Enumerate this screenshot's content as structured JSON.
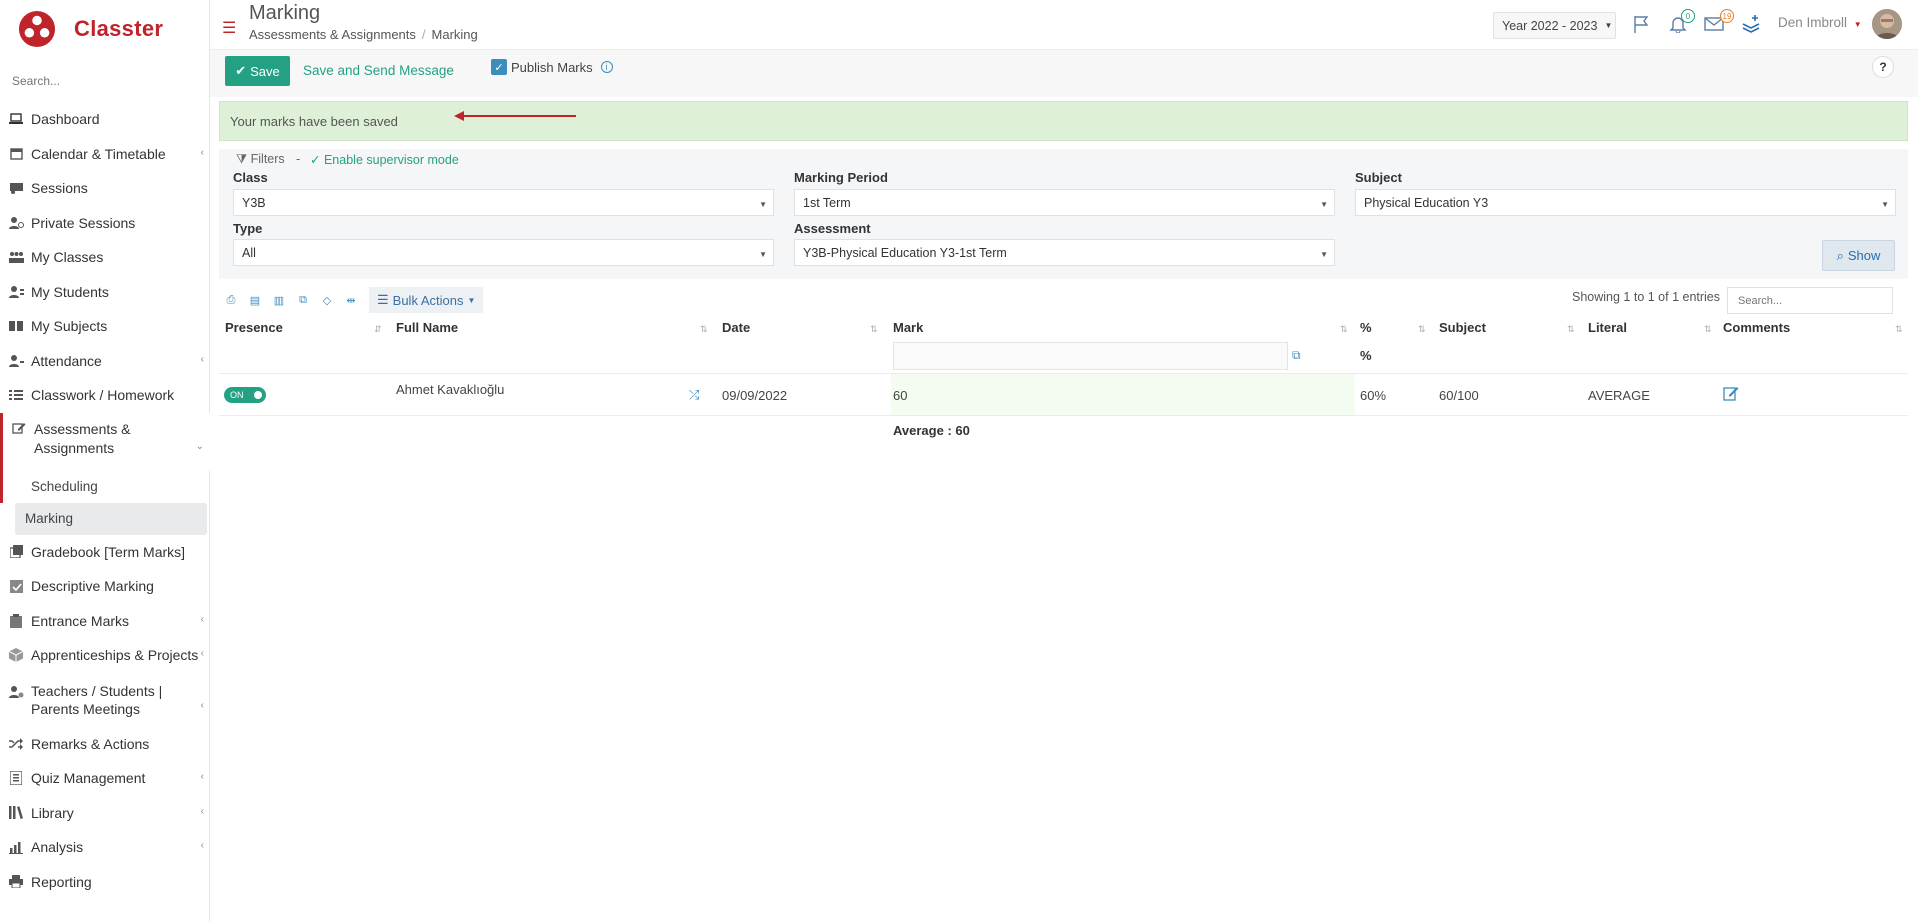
{
  "brand": {
    "name": "Classter",
    "color": "#c0242b"
  },
  "sidebar": {
    "search_placeholder": "Search...",
    "items": [
      {
        "label": "Dashboard",
        "icon": "laptop-icon"
      },
      {
        "label": "Calendar & Timetable",
        "icon": "calendar-icon"
      },
      {
        "label": "Sessions",
        "icon": "sessions-icon"
      },
      {
        "label": "Private Sessions",
        "icon": "private-sessions-icon"
      },
      {
        "label": "My Classes",
        "icon": "classes-icon"
      },
      {
        "label": "My Students",
        "icon": "students-icon"
      },
      {
        "label": "My Subjects",
        "icon": "book-icon"
      },
      {
        "label": "Attendance",
        "icon": "attendance-icon"
      },
      {
        "label": "Classwork / Homework",
        "icon": "list-icon"
      },
      {
        "label": "Assessments & Assignments",
        "icon": "edit-icon"
      },
      {
        "label": "Scheduling"
      },
      {
        "label": "Marking"
      },
      {
        "label": "Gradebook [Term Marks]",
        "icon": "gradebook-icon"
      },
      {
        "label": "Descriptive Marking",
        "icon": "check-square-icon"
      },
      {
        "label": "Entrance Marks",
        "icon": "clipboard-icon"
      },
      {
        "label": "Apprenticeships & Projects",
        "icon": "cube-icon"
      },
      {
        "label": "Teachers / Students | Parents Meetings",
        "icon": "meetings-icon"
      },
      {
        "label": "Remarks & Actions",
        "icon": "shuffle-icon"
      },
      {
        "label": "Quiz Management",
        "icon": "quiz-icon"
      },
      {
        "label": "Library",
        "icon": "library-icon"
      },
      {
        "label": "Analysis",
        "icon": "chart-icon"
      },
      {
        "label": "Reporting",
        "icon": "printer-icon"
      }
    ]
  },
  "header": {
    "title": "Marking",
    "breadcrumb": [
      "Assessments & Assignments",
      "Marking"
    ],
    "year": "Year 2022 - 2023",
    "notifications_count": "0",
    "messages_count": "19",
    "user_name": "Den Imbroll"
  },
  "toolbar": {
    "save_label": "Save",
    "save_send_label": "Save and Send Message",
    "publish_label": "Publish Marks",
    "help_label": "?"
  },
  "alert": {
    "text": "Your marks have been saved"
  },
  "filters": {
    "title": "Filters",
    "separator": "-",
    "supervisor_label": "Enable supervisor mode",
    "class_label": "Class",
    "class_value": "Y3B",
    "period_label": "Marking Period",
    "period_value": "1st Term",
    "subject_label": "Subject",
    "subject_value": "Physical Education Y3",
    "type_label": "Type",
    "type_value": "All",
    "assessment_label": "Assessment",
    "assessment_value": "Y3B-Physical Education Y3-1st Term",
    "show_label": "Show"
  },
  "table": {
    "bulk_label": "Bulk Actions",
    "entries_text": "Showing 1 to 1 of 1 entries",
    "search_placeholder": "Search...",
    "columns": [
      "Presence",
      "Full Name",
      "Date",
      "Mark",
      "%",
      "Subject",
      "Literal",
      "Comments"
    ],
    "percent_subheader": "%",
    "rows": [
      {
        "presence": "ON",
        "name": "Ahmet Kavaklıoğlu",
        "date": "09/09/2022",
        "mark": "60",
        "percent": "60%",
        "subject": "60/100",
        "literal": "AVERAGE"
      }
    ],
    "average": "Average : 60"
  }
}
